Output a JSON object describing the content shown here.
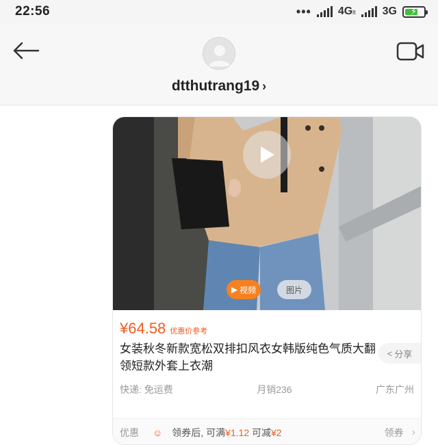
{
  "status_bar": {
    "time": "22:56",
    "dots": "•••",
    "network_1": "4G",
    "network_1_suffix": "lt",
    "network_2": "3G"
  },
  "header": {
    "username": "dtthutrang19",
    "chevron": "›"
  },
  "product_card": {
    "tag_video": "视频",
    "tag_image": "图片",
    "price": "¥64.58",
    "price_note": "优惠价参考",
    "title": "女装秋冬新款宽松双排扣风衣女韩版纯色气质大翻领短款外套上衣潮",
    "share_label": "分享",
    "shipping": "快递: 免运费",
    "monthly_sales": "月销236",
    "location": "广东广州",
    "coupon": {
      "label": "优惠",
      "text_prefix": "领券后, 可满",
      "amount_1": "¥1.12",
      "text_middle": " 可减",
      "amount_2": "¥2",
      "action": "领券"
    }
  },
  "colors": {
    "accent_orange": "#f55a1e",
    "video_tag": "#f58220"
  }
}
